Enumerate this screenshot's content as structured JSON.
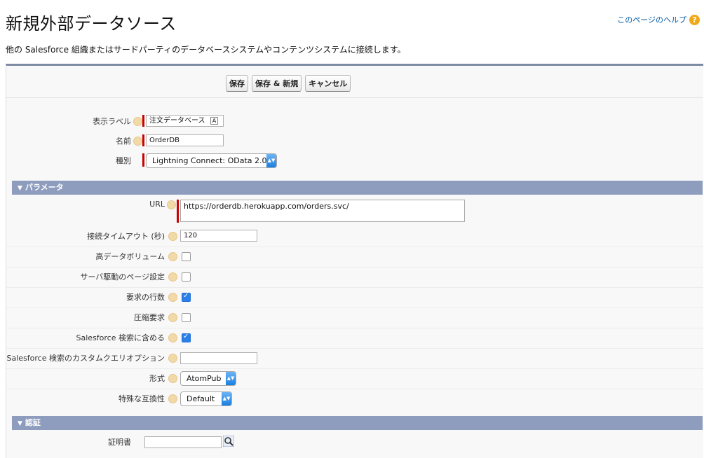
{
  "page": {
    "title": "新規外部データソース",
    "help_link": "このページのヘルプ",
    "subtitle": "他の Salesforce 組織またはサードパーティのデータベースシステムやコンテンツシステムに接続します。"
  },
  "buttons": {
    "save": "保存",
    "save_new": "保存 & 新規",
    "cancel": "キャンセル"
  },
  "fields": {
    "display_label": {
      "label": "表示ラベル",
      "value": "注文データベース"
    },
    "name": {
      "label": "名前",
      "value": "OrderDB"
    },
    "type": {
      "label": "種別",
      "value": "Lightning Connect: OData 2.0"
    }
  },
  "params": {
    "header": "パラメータ",
    "url": {
      "label": "URL",
      "value": "https://orderdb.herokuapp.com/orders.svc/"
    },
    "timeout": {
      "label": "接続タイムアウト (秒)",
      "value": "120"
    },
    "high_volume": {
      "label": "高データボリューム",
      "checked": false
    },
    "server_paging": {
      "label": "サーバ駆動のページ設定",
      "checked": false
    },
    "request_row_count": {
      "label": "要求の行数",
      "checked": true
    },
    "compression": {
      "label": "圧縮要求",
      "checked": false
    },
    "include_search": {
      "label": "Salesforce 検索に含める",
      "checked": true
    },
    "custom_query": {
      "label": "Salesforce 検索のカスタムクエリオプション",
      "value": ""
    },
    "format": {
      "label": "形式",
      "value": "AtomPub"
    },
    "compat": {
      "label": "特殊な互換性",
      "value": "Default"
    }
  },
  "auth": {
    "header": "認証",
    "certificate": {
      "label": "証明書",
      "value": ""
    }
  },
  "colors": {
    "section": "#8e9dbe",
    "required": "#cc0000",
    "link": "#015ba7"
  }
}
